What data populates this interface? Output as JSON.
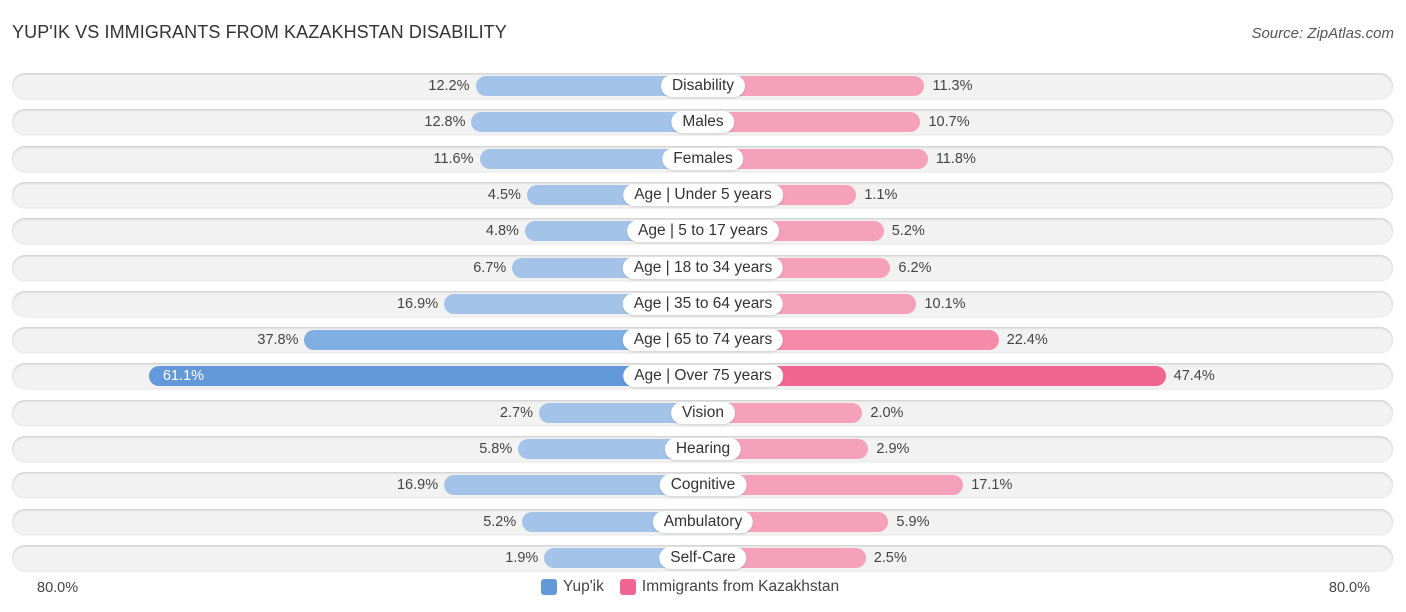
{
  "header": {
    "title": "YUP'IK VS IMMIGRANTS FROM KAZAKHSTAN DISABILITY",
    "source": "Source: ZipAtlas.com"
  },
  "colors": {
    "left_light": "#a3c4e8",
    "left_strong": "#6399d9",
    "right_light": "#f5a1bc",
    "right_strong": "#f06591"
  },
  "chart_data": {
    "type": "bar",
    "orientation": "horizontal-diverging",
    "title": "YUP'IK VS IMMIGRANTS FROM KAZAKHSTAN DISABILITY",
    "categories": [
      "Disability",
      "Males",
      "Females",
      "Age | Under 5 years",
      "Age | 5 to 17 years",
      "Age | 18 to 34 years",
      "Age | 35 to 64 years",
      "Age | 65 to 74 years",
      "Age | Over 75 years",
      "Vision",
      "Hearing",
      "Cognitive",
      "Ambulatory",
      "Self-Care"
    ],
    "series": [
      {
        "name": "Yup'ik",
        "side": "left",
        "values": [
          12.2,
          12.8,
          11.6,
          4.5,
          4.8,
          6.7,
          16.9,
          37.8,
          61.1,
          2.7,
          5.8,
          16.9,
          5.2,
          1.9
        ],
        "labels": [
          "12.2%",
          "12.8%",
          "11.6%",
          "4.5%",
          "4.8%",
          "6.7%",
          "16.9%",
          "37.8%",
          "61.1%",
          "2.7%",
          "5.8%",
          "16.9%",
          "5.2%",
          "1.9%"
        ]
      },
      {
        "name": "Immigrants from Kazakhstan",
        "side": "right",
        "values": [
          11.3,
          10.7,
          11.8,
          1.1,
          5.2,
          6.2,
          10.1,
          22.4,
          47.4,
          2.0,
          2.9,
          17.1,
          5.9,
          2.5
        ],
        "labels": [
          "11.3%",
          "10.7%",
          "11.8%",
          "1.1%",
          "5.2%",
          "6.2%",
          "10.1%",
          "22.4%",
          "47.4%",
          "2.0%",
          "2.9%",
          "17.1%",
          "5.9%",
          "2.5%"
        ]
      }
    ],
    "xlim": [
      -80,
      80
    ],
    "axis_labels": {
      "left": "80.0%",
      "right": "80.0%"
    },
    "unit": "%",
    "legend_position": "bottom-center",
    "grid": false
  },
  "legend": {
    "items": [
      {
        "label": "Yup'ik",
        "color": "#6399d9"
      },
      {
        "label": "Immigrants from Kazakhstan",
        "color": "#f06591"
      }
    ]
  }
}
